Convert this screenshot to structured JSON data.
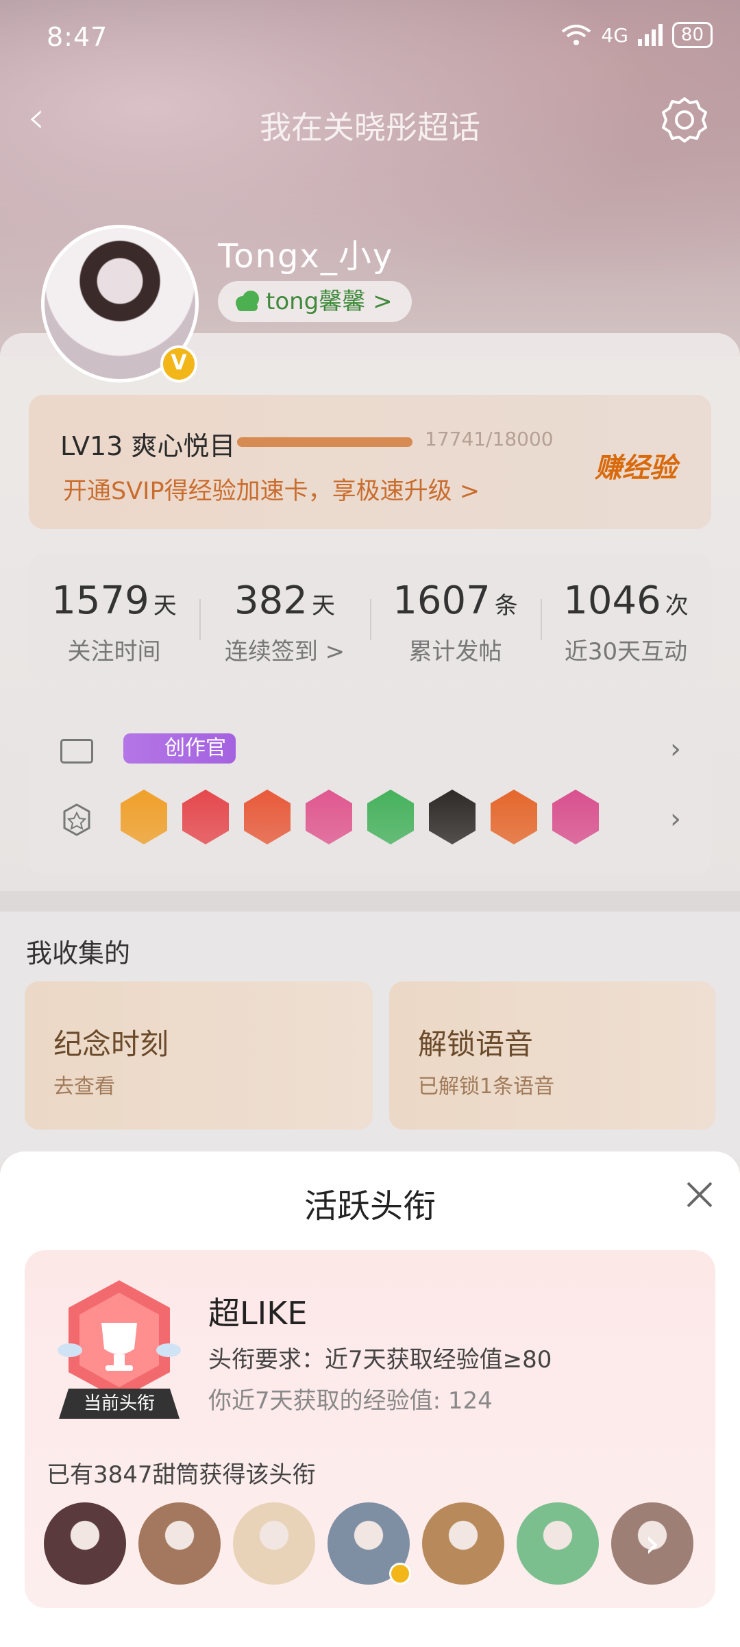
{
  "status_bar": {
    "time": "8:47",
    "network": "4G",
    "battery": "80"
  },
  "nav": {
    "title": "我在关晓彤超话",
    "back_icon": "chevron-left-icon",
    "settings_icon": "gear-icon"
  },
  "profile": {
    "username": "Tongx_小y",
    "tag": "tong馨馨 >"
  },
  "level": {
    "label": "LV13 爽心悦目",
    "progress": 0.9856,
    "exp_text": "17741/18000",
    "svip_text": "开通SVIP得经验加速卡，享极速升级 >",
    "earn_label": "赚经验"
  },
  "stats": [
    {
      "num": "1579",
      "unit": "天",
      "label": "关注时间"
    },
    {
      "num": "382",
      "unit": "天",
      "label": "连续签到 >"
    },
    {
      "num": "1607",
      "unit": "条",
      "label": "累计发帖"
    },
    {
      "num": "1046",
      "unit": "次",
      "label": "近30天互动"
    }
  ],
  "honor": {
    "creator_label": "创作官",
    "medal_colors": [
      "#f0a02a",
      "#e5484d",
      "#e85a3a",
      "#e0578f",
      "#45b25c",
      "#2e2a28",
      "#e5672c",
      "#d9508e",
      "#f0a02a"
    ]
  },
  "collection": {
    "heading": "我收集的",
    "items": [
      {
        "title": "纪念时刻",
        "subtitle": "去查看"
      },
      {
        "title": "解锁语音",
        "subtitle": "已解锁1条语音"
      }
    ]
  },
  "sheet": {
    "title": "活跃头衔",
    "current_tag": "当前头衔",
    "name": "超LIKE",
    "requirement": "头衔要求：近7天获取经验值≥80",
    "mine": "你近7天获取的经验值: 124",
    "owners": "已有3847甜筒获得该头衔",
    "avatar_colors": [
      "#5a3a3c",
      "#a3785e",
      "#e8d3b9",
      "#7f8fa3",
      "#b88a5b",
      "#7cbf8f",
      "#9e7f75"
    ]
  }
}
